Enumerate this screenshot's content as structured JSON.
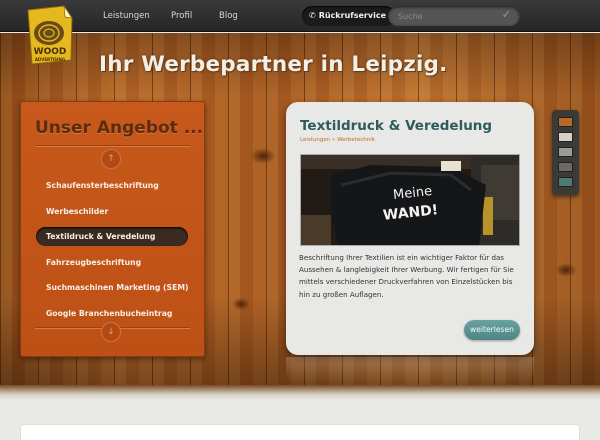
{
  "nav": {
    "links": [
      "Leistungen",
      "Profil",
      "Blog"
    ],
    "callback_icon": "✆",
    "callback_label": "Rückrufservice",
    "search_placeholder": "Suche",
    "search_icon": "checkmark-icon"
  },
  "logo": {
    "line1": "WOOD",
    "line2": "ADVERTISING"
  },
  "headline": "Ihr Werbepartner in Leipzig.",
  "sidebar": {
    "title": "Unser Angebot ...",
    "items": [
      {
        "label": "Schaufensterbeschriftung"
      },
      {
        "label": "Werbeschilder"
      },
      {
        "label": "Textildruck & Veredelung",
        "active": true
      },
      {
        "label": "Fahrzeugbeschriftung"
      },
      {
        "label": "Suchmaschinen Marketing (SEM)"
      },
      {
        "label": "Google Branchenbucheintrag"
      }
    ],
    "arrow_up": "↑",
    "arrow_down": "↓"
  },
  "card": {
    "title": "Textildruck & Veredelung",
    "breadcrumb": "Leistungen » Werbetechnik",
    "photo_shirt_text_1": "Meine",
    "photo_shirt_text_2": "WAND!",
    "body": "Beschriftung Ihrer Textilien ist ein wichtiger Faktor für das Aussehen & langlebigkeit Ihrer Werbung. Wir fertigen für Sie mittels verschiedener Druckverfahren von Einzelstücken bis hin zu großen Auflagen.",
    "more_label": "weiterlesen"
  },
  "swatches": [
    "#b8692a",
    "#d8cfc2",
    "#9a9a98",
    "#6e6a63",
    "#4d7a72"
  ],
  "colors": {
    "accent": "#c8591c",
    "card_title": "#2e5b5b",
    "button": "#5a9391"
  }
}
